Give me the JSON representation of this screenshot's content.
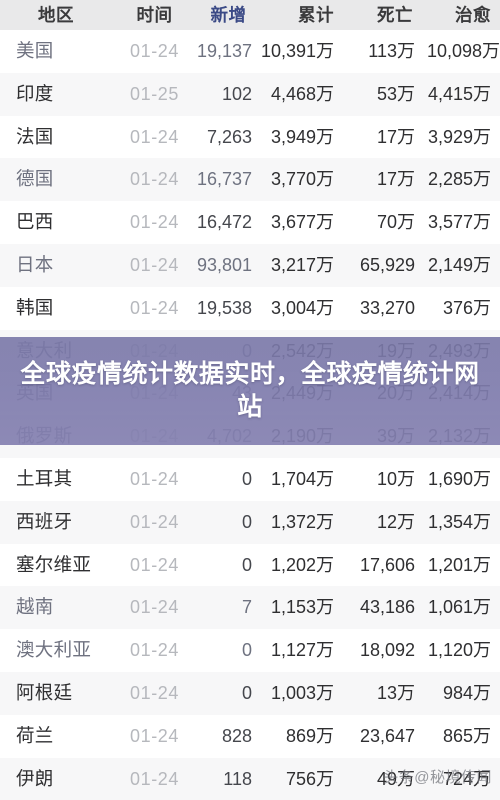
{
  "table": {
    "columns": [
      {
        "key": "region",
        "label": "地区",
        "align": "center"
      },
      {
        "key": "time",
        "label": "时间",
        "align": "center"
      },
      {
        "key": "new",
        "label": "新增",
        "align": "center",
        "color": "#3b4a86"
      },
      {
        "key": "total",
        "label": "累计",
        "align": "right"
      },
      {
        "key": "death",
        "label": "死亡",
        "align": "right"
      },
      {
        "key": "cured",
        "label": "治愈",
        "align": "right"
      }
    ],
    "rows": [
      {
        "region": "美国",
        "time": "01-24",
        "new": "19,137",
        "total": "10,391万",
        "death": "113万",
        "cured": "10,098万"
      },
      {
        "region": "印度",
        "time": "01-25",
        "new": "102",
        "total": "4,468万",
        "death": "53万",
        "cured": "4,415万"
      },
      {
        "region": "法国",
        "time": "01-24",
        "new": "7,263",
        "total": "3,949万",
        "death": "17万",
        "cured": "3,929万"
      },
      {
        "region": "德国",
        "time": "01-24",
        "new": "16,737",
        "total": "3,770万",
        "death": "17万",
        "cured": "2,285万"
      },
      {
        "region": "巴西",
        "time": "01-24",
        "new": "16,472",
        "total": "3,677万",
        "death": "70万",
        "cured": "3,577万"
      },
      {
        "region": "日本",
        "time": "01-24",
        "new": "93,801",
        "total": "3,217万",
        "death": "65,929",
        "cured": "2,149万"
      },
      {
        "region": "韩国",
        "time": "01-24",
        "new": "19,538",
        "total": "3,004万",
        "death": "33,270",
        "cured": "376万"
      },
      {
        "region": "意大利",
        "time": "01-24",
        "new": "0",
        "total": "2,542万",
        "death": "19万",
        "cured": "2,493万"
      },
      {
        "region": "英国",
        "time": "01-24",
        "new": "43",
        "total": "2,449万",
        "death": "20万",
        "cured": "2,414万"
      },
      {
        "region": "俄罗斯",
        "time": "01-24",
        "new": "4,702",
        "total": "2,190万",
        "death": "39万",
        "cured": "2,132万"
      },
      {
        "region": "土耳其",
        "time": "01-24",
        "new": "0",
        "total": "1,704万",
        "death": "10万",
        "cured": "1,690万"
      },
      {
        "region": "西班牙",
        "time": "01-24",
        "new": "0",
        "total": "1,372万",
        "death": "12万",
        "cured": "1,354万"
      },
      {
        "region": "塞尔维亚",
        "time": "01-24",
        "new": "0",
        "total": "1,202万",
        "death": "17,606",
        "cured": "1,201万"
      },
      {
        "region": "越南",
        "time": "01-24",
        "new": "7",
        "total": "1,153万",
        "death": "43,186",
        "cured": "1,061万"
      },
      {
        "region": "澳大利亚",
        "time": "01-24",
        "new": "0",
        "total": "1,127万",
        "death": "18,092",
        "cured": "1,120万"
      },
      {
        "region": "阿根廷",
        "time": "01-24",
        "new": "0",
        "total": "1,003万",
        "death": "13万",
        "cured": "984万"
      },
      {
        "region": "荷兰",
        "time": "01-24",
        "new": "828",
        "total": "869万",
        "death": "23,647",
        "cured": "865万"
      },
      {
        "region": "伊朗",
        "time": "01-24",
        "new": "118",
        "total": "756万",
        "death": "49万",
        "cured": "724万"
      }
    ]
  },
  "overlay": {
    "title": "全球疫情统计数据实时，全球疫情统计网站",
    "background_color": "#7a78a8",
    "text_color": "#ffffff"
  },
  "watermark": {
    "text": "头条@秘境传闻"
  },
  "theme": {
    "header_background": "#e9e9ea",
    "header_text": "#3a3a3c",
    "accent_column_color": "#3b4a86",
    "row_odd_background": "#ffffff",
    "row_even_background": "#f7f7f8",
    "time_text_color": "#b6b8bd"
  }
}
